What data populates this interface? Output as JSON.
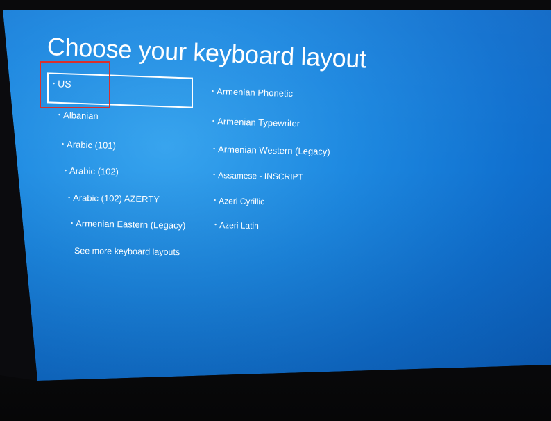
{
  "page": {
    "title": "Choose your keyboard layout"
  },
  "layouts": {
    "left": [
      {
        "label": "US",
        "selected": true
      },
      {
        "label": "Albanian"
      },
      {
        "label": "Arabic (101)"
      },
      {
        "label": "Arabic (102)"
      },
      {
        "label": "Arabic (102) AZERTY"
      },
      {
        "label": "Armenian Eastern (Legacy)"
      }
    ],
    "right": [
      {
        "label": "Armenian Phonetic"
      },
      {
        "label": "Armenian Typewriter"
      },
      {
        "label": "Armenian Western (Legacy)"
      },
      {
        "label": "Assamese - INSCRIPT"
      },
      {
        "label": "Azeri Cyrillic"
      },
      {
        "label": "Azeri Latin"
      }
    ]
  },
  "more": {
    "label": "See more keyboard layouts"
  },
  "colors": {
    "screen_blue": "#1d88e0",
    "text": "#ffffff",
    "annotation": "#d9302c"
  }
}
